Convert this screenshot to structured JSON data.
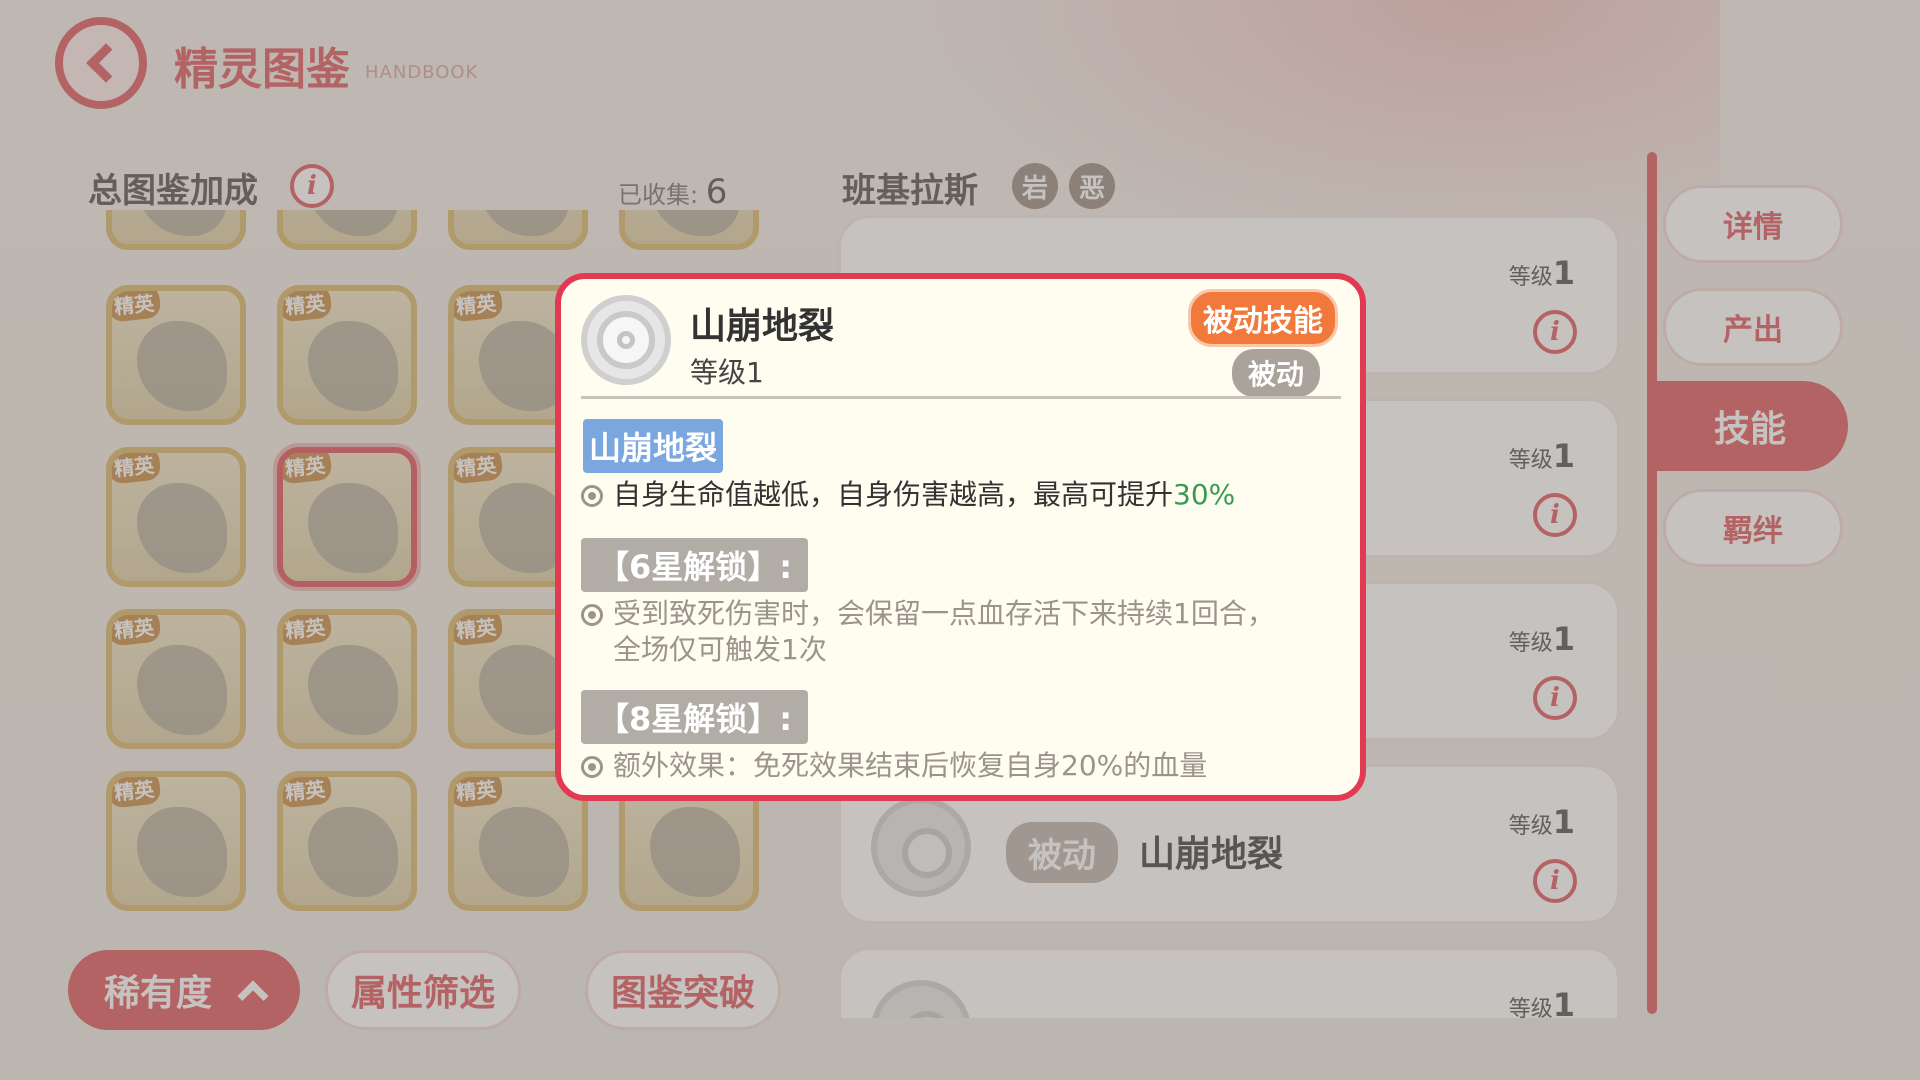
{
  "header": {
    "title": "精灵图鉴",
    "subtitle": "HANDBOOK"
  },
  "left_panel": {
    "bonus_label": "总图鉴加成",
    "collected_label": "已收集:",
    "collected_count": "6",
    "elite_tag": "精英"
  },
  "filters": {
    "rarity": "稀有度",
    "attribute": "属性筛选",
    "breakthrough": "图鉴突破"
  },
  "pet": {
    "name": "班基拉斯",
    "types": [
      "岩",
      "恶"
    ]
  },
  "skill_rows": [
    {
      "level_label": "等级",
      "level": "1"
    },
    {
      "level_label": "等级",
      "level": "1"
    },
    {
      "level_label": "等级",
      "level": "1"
    },
    {
      "level_label": "等级",
      "level": "1",
      "tag": "被动",
      "name": "山崩地裂"
    },
    {
      "level_label": "等级",
      "level": "1"
    }
  ],
  "side_tabs": [
    "详情",
    "产出",
    "技能",
    "羁绊"
  ],
  "active_side_tab": "技能",
  "popup": {
    "title": "山崩地裂",
    "level": "等级1",
    "category_badge": "被动技能",
    "type_tag": "被动",
    "effect_title": "山崩地裂",
    "effect_text": "自身生命值越低，自身伤害越高，最高可提升",
    "effect_value": "30%",
    "unlock6_title": "【6星解锁】:",
    "unlock6_text_line1": "受到致死伤害时，会保留一点血存活下来持续1回合，",
    "unlock6_text_line2": "全场仅可触发1次",
    "unlock8_title": "【8星解锁】:",
    "unlock8_text": "额外效果：免死效果结束后恢复自身20%的血量"
  },
  "colors": {
    "accent": "#e05c62",
    "popup_border": "#e23a52",
    "badge_orange": "#f0793b",
    "highlight_blue": "#7aa7e0",
    "green_value": "#3a9a52"
  }
}
